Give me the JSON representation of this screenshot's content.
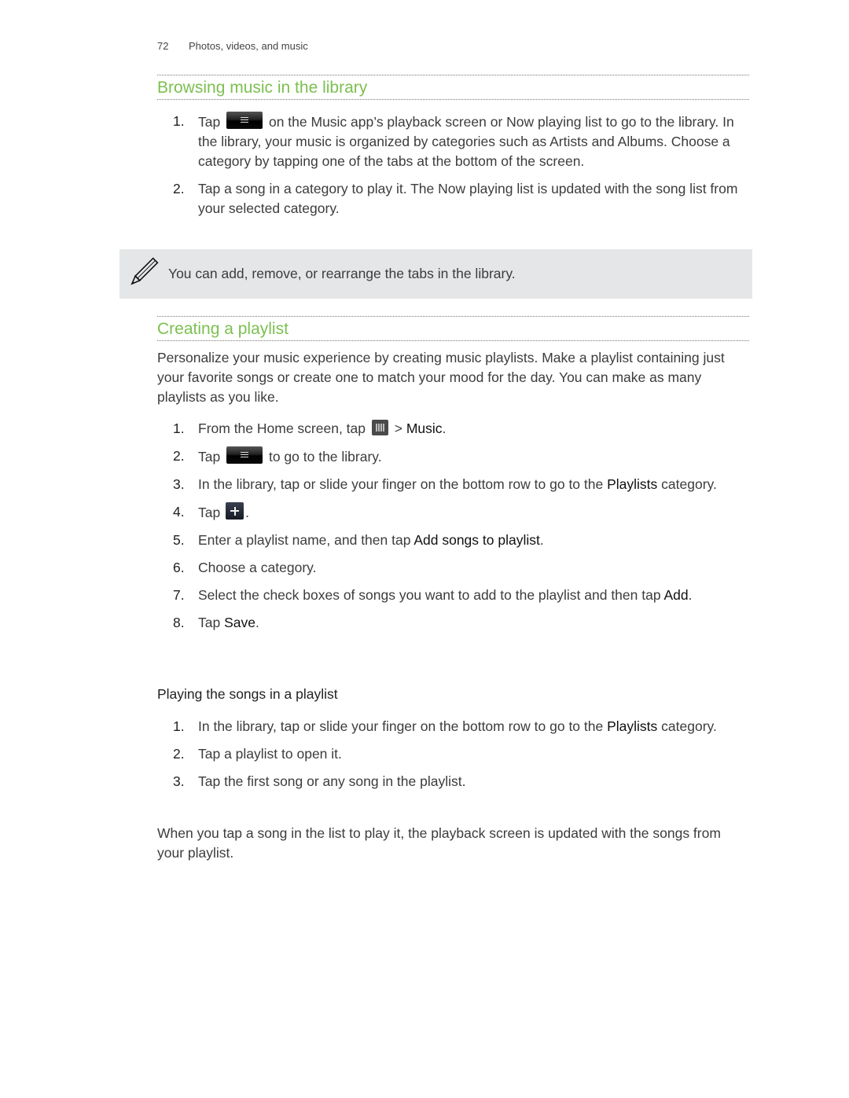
{
  "header": {
    "page_number": "72",
    "chapter": "Photos, videos, and music"
  },
  "section1": {
    "title": "Browsing music in the library",
    "steps": [
      {
        "num": "1.",
        "pre": "Tap",
        "icon": "menu-icon",
        "post": "on the Music app’s playback screen or Now playing list to go to the library. In the library, your music is organized by categories such as Artists and Albums. Choose a category by tapping one of the tabs at the bottom of the screen."
      },
      {
        "num": "2.",
        "text": "Tap a song in a category to play it. The Now playing list is updated with the song list from your selected category."
      }
    ],
    "note": {
      "icon": "pencil-icon",
      "text": "You can add, remove, or rearrange the tabs in the library."
    }
  },
  "section2": {
    "title": "Creating a playlist",
    "intro": "Personalize your music experience by creating music playlists. Make a playlist containing just your favorite songs or create one to match your mood for the day. You can make as many playlists as you like.",
    "steps": [
      {
        "num": "1.",
        "pre": "From the Home screen, tap",
        "icon": "all-apps-icon",
        "mid": " > ",
        "ui": "Music",
        "post": "."
      },
      {
        "num": "2.",
        "pre": "Tap",
        "icon": "menu-icon",
        "post": "to go to the library."
      },
      {
        "num": "3.",
        "pre": "In the library, tap or slide your finger on the bottom row to go to the ",
        "ui": "Playlists",
        "post": " category."
      },
      {
        "num": "4.",
        "pre": "Tap",
        "icon": "add-icon",
        "post": "."
      },
      {
        "num": "5.",
        "pre": "Enter a playlist name, and then tap ",
        "ui": "Add songs to playlist",
        "post": "."
      },
      {
        "num": "6.",
        "text": "Choose a category."
      },
      {
        "num": "7.",
        "pre": "Select the check boxes of songs you want to add to the playlist and then tap ",
        "ui": "Add",
        "post": "."
      },
      {
        "num": "8.",
        "pre": "Tap ",
        "ui": "Save",
        "post": "."
      }
    ],
    "subheading": "Playing the songs in a playlist",
    "play_steps": [
      {
        "num": "1.",
        "pre": "In the library, tap or slide your finger on the bottom row to go to the ",
        "ui": "Playlists",
        "post": " category."
      },
      {
        "num": "2.",
        "text": "Tap a playlist to open it."
      },
      {
        "num": "3.",
        "text": "Tap the first song or any song in the playlist."
      }
    ],
    "closing": "When you tap a song in the list to play it, the playback screen is updated with the songs from your playlist."
  },
  "colors": {
    "heading_green": "#7cc050",
    "note_bg": "#e5e6e7"
  }
}
